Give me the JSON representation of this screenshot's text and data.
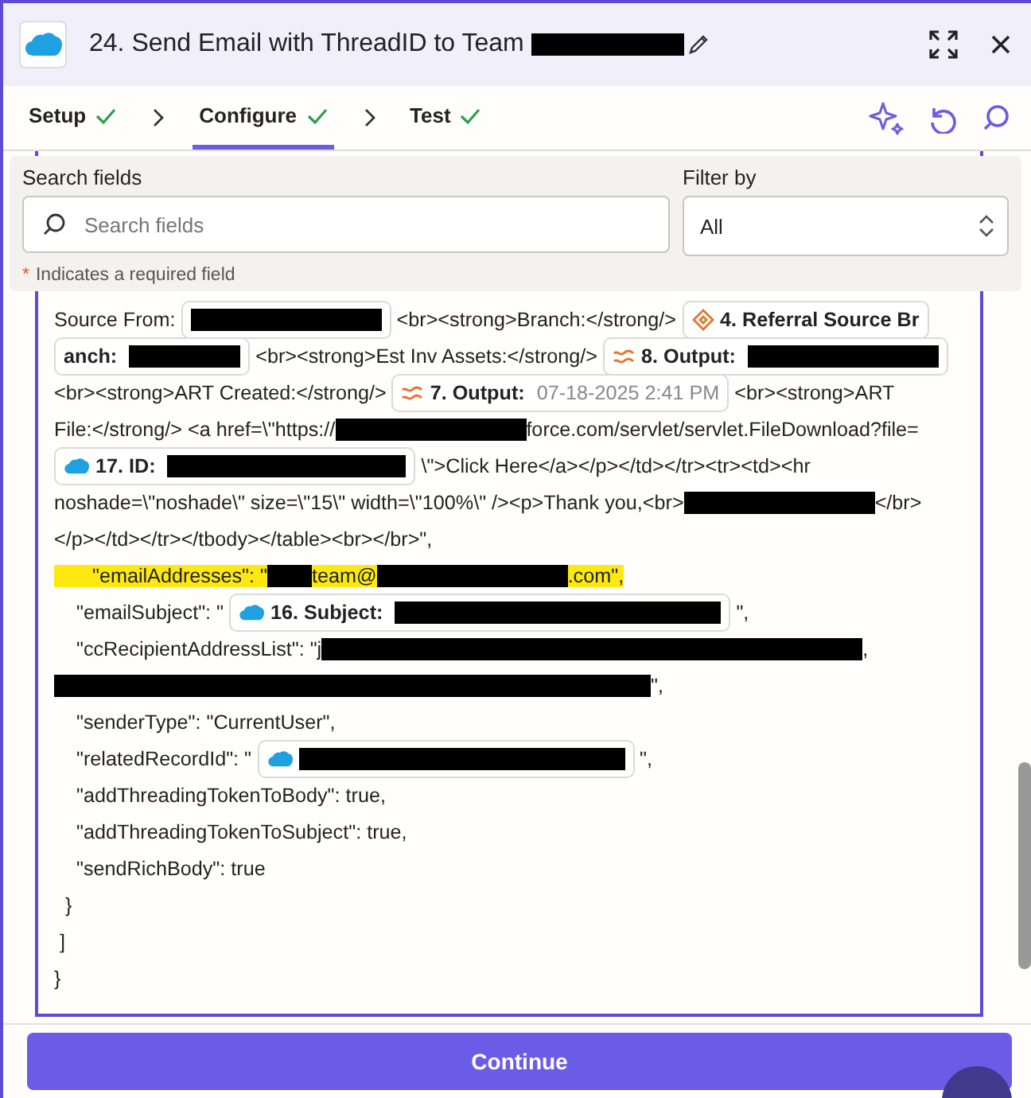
{
  "header": {
    "title": "24. Send Email with ThreadID to Team ",
    "title_redacted": true
  },
  "tabs": [
    {
      "label": "Setup",
      "selected": false,
      "done": true
    },
    {
      "label": "Configure",
      "selected": true,
      "done": true
    },
    {
      "label": "Test",
      "selected": false,
      "done": true
    }
  ],
  "filters": {
    "search_label": "Search fields",
    "search_placeholder": "Search fields",
    "filter_label": "Filter by",
    "filter_value": "All",
    "required_mark": "*",
    "required_note": "Indicates a required field"
  },
  "editor": {
    "lines": [
      {
        "highlighted": false,
        "segments": [
          {
            "kind": "text",
            "text": "Source From: "
          },
          {
            "kind": "pill-plain",
            "content": [
              {
                "kind": "redaction-medium"
              }
            ]
          },
          {
            "kind": "text",
            "text": " <br><strong>Branch:</strong/> "
          },
          {
            "kind": "pill-diamond",
            "content": [
              {
                "kind": "label",
                "text": "4. Referral Source Br"
              }
            ]
          }
        ]
      },
      {
        "highlighted": false,
        "segments": [
          {
            "kind": "pill-plain",
            "content": [
              {
                "kind": "label",
                "text": "anch: "
              },
              {
                "kind": "redaction-short"
              }
            ]
          },
          {
            "kind": "text",
            "text": " <br><strong>Est Inv Assets:</strong/> "
          },
          {
            "kind": "pill-formatter",
            "content": [
              {
                "kind": "label",
                "text": "8. Output: "
              },
              {
                "kind": "redaction-medium"
              }
            ]
          }
        ]
      },
      {
        "highlighted": false,
        "segments": [
          {
            "kind": "text",
            "text": "<br><strong>ART Created:</strong/> "
          },
          {
            "kind": "pill-formatter",
            "content": [
              {
                "kind": "label",
                "text": "7. Output: "
              },
              {
                "kind": "value",
                "text": "07-18-2025 2:41 PM"
              }
            ]
          },
          {
            "kind": "text",
            "text": " <br><strong>ART"
          }
        ]
      },
      {
        "highlighted": false,
        "segments": [
          {
            "kind": "text",
            "text": "File:</strong/> <a href=\\\"https://"
          },
          {
            "kind": "redaction-medium"
          },
          {
            "kind": "text",
            "text": "force.com/servlet/servlet.FileDownload?file="
          }
        ]
      },
      {
        "highlighted": false,
        "segments": [
          {
            "kind": "pill-app",
            "content": [
              {
                "kind": "label",
                "text": "17. ID: "
              },
              {
                "kind": "redaction-long"
              }
            ]
          },
          {
            "kind": "text",
            "text": " \\\">Click Here</a></p></td></tr><tr><td><hr"
          }
        ]
      },
      {
        "highlighted": false,
        "segments": [
          {
            "kind": "text",
            "text": "noshade=\\\"noshade\\\" size=\\\"15\\\" width=\\\"100%\\\" /><p>Thank you,<br>"
          },
          {
            "kind": "redaction-medium"
          },
          {
            "kind": "text",
            "text": "</br>"
          }
        ]
      },
      {
        "highlighted": false,
        "segments": [
          {
            "kind": "text",
            "text": "</p></td></tr></tbody></table><br></br>\","
          }
        ]
      },
      {
        "highlighted": true,
        "segments": [
          {
            "kind": "text",
            "text": "    \"emailAddresses\": \""
          },
          {
            "kind": "redaction-tiny"
          },
          {
            "kind": "text",
            "text": "team@"
          },
          {
            "kind": "redaction-medium"
          },
          {
            "kind": "text",
            "text": ".com\","
          }
        ]
      },
      {
        "highlighted": false,
        "segments": [
          {
            "kind": "text",
            "text": "    \"emailSubject\": \" "
          },
          {
            "kind": "pill-app",
            "content": [
              {
                "kind": "label",
                "text": "16. Subject: "
              },
              {
                "kind": "redaction-xlong"
              }
            ]
          },
          {
            "kind": "text",
            "text": " \","
          }
        ]
      },
      {
        "highlighted": false,
        "segments": [
          {
            "kind": "text",
            "text": "    \"ccRecipientAddressList\": \"j"
          },
          {
            "kind": "redaction-line"
          },
          {
            "kind": "text",
            "text": ","
          }
        ]
      },
      {
        "highlighted": false,
        "segments": [
          {
            "kind": "redaction-fullline"
          },
          {
            "kind": "text",
            "text": "\","
          }
        ]
      },
      {
        "highlighted": false,
        "segments": [
          {
            "kind": "text",
            "text": "    \"senderType\": \"CurrentUser\","
          }
        ]
      },
      {
        "highlighted": false,
        "segments": [
          {
            "kind": "text",
            "text": "    \"relatedRecordId\": \" "
          },
          {
            "kind": "pill-app",
            "content": [
              {
                "kind": "redaction-xlong"
              }
            ]
          },
          {
            "kind": "text",
            "text": " \","
          }
        ]
      },
      {
        "highlighted": false,
        "segments": [
          {
            "kind": "text",
            "text": "    \"addThreadingTokenToBody\": true,"
          }
        ]
      },
      {
        "highlighted": false,
        "segments": [
          {
            "kind": "text",
            "text": "    \"addThreadingTokenToSubject\": true,"
          }
        ]
      },
      {
        "highlighted": false,
        "segments": [
          {
            "kind": "text",
            "text": "    \"sendRichBody\": true"
          }
        ]
      },
      {
        "highlighted": false,
        "segments": [
          {
            "kind": "text",
            "text": "  }"
          }
        ]
      },
      {
        "highlighted": false,
        "segments": [
          {
            "kind": "text",
            "text": " ]"
          }
        ]
      },
      {
        "highlighted": false,
        "segments": [
          {
            "kind": "text",
            "text": "}"
          }
        ]
      }
    ]
  },
  "footer": {
    "button": "Continue"
  }
}
